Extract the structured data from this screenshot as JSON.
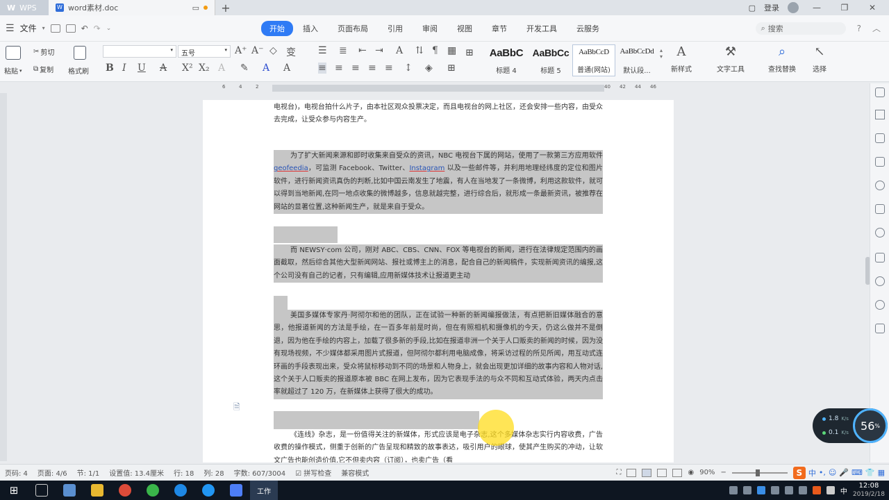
{
  "titlebar": {
    "app_tab": "WPS",
    "doc_tab": "word素材.doc",
    "add_tab": "+",
    "login": "登录"
  },
  "menubar": {
    "file": "文件",
    "tabs": [
      "开始",
      "插入",
      "页面布局",
      "引用",
      "审阅",
      "视图",
      "章节",
      "开发工具",
      "云服务"
    ],
    "active_tab": "开始",
    "search_placeholder": "搜索",
    "help": "?"
  },
  "ribbon": {
    "cut": "剪切",
    "copy": "复制",
    "paste": "粘贴",
    "format_painter": "格式刷",
    "font_name": "",
    "font_size": "五号",
    "styles": [
      {
        "sample": "AaBbC",
        "name": "标题 4"
      },
      {
        "sample": "AaBbCc",
        "name": "标题 5"
      },
      {
        "sample": "AaBbCcD",
        "name": "普通(网站)"
      },
      {
        "sample": "AaBbCcDd",
        "name": "默认段..."
      }
    ],
    "new_style": "新样式",
    "text_tools": "文字工具",
    "find_replace": "查找替换",
    "select": "选择"
  },
  "ruler": {
    "left_ticks": [
      "6",
      "4",
      "2"
    ],
    "right_ticks": [
      "40",
      "42",
      "44",
      "46"
    ]
  },
  "document": {
    "para0": "电视台)，电视台拍什么片子，由本社区观众投票决定，而且电视台的网上社区，还会安排一些内容，由受众去完成，让受众参与内容生产。",
    "para1_a": "为了扩大新闻来源和即时收集来自受众的资讯，NBC 电视台下属的网站，使用了一款第三方应用软件 ",
    "para1_link1": "geofeedia",
    "para1_b": "，可监测 Facebook、Twitter、",
    "para1_link2": "Instagram",
    "para1_c": " 以及一些邮件等，并利用地理经纬度的定位和图片软件，进行新闻资讯真伪的判断,比如中国云南发生了地震，有人在当地发了一条微博，利用这款软件，就可以得到当地新闻,在同一地点收集的微博越多，信息就越完整，进行综合后，就形成一条最新资讯，被推荐在网站的显著位置,这种新闻生产，就是来自于受众。",
    "para2": "而 NEWSY·com 公司，刚对 ABC、CBS、CNN、FOX 等电视台的新闻，进行在法律规定范围内的画面截取，然后综合其他大型新闻网站、报社或博主上的消息，配合自己的新闻稿件，实现新闻资讯的编报,这个公司没有自己的记者，只有编辑,应用新媒体技术让报道更主动",
    "para3": "美国多媒体专家丹·阿彻尔和他的团队，正在试验一种新的新闻编报做法，有点把新旧媒体融合的意思，他报道新闻的方法是手绘，在一百多年前是时尚，但在有照相机和摄像机的今天，仍这么做并不是倒退，因为他在手绘的内容上，加载了很多新的手段,比如在报道非洲一个关于人口贩卖的新闻的时候，因为没有现场视频，不少媒体都采用图片式报道，但阿彻尔都利用电脑成像，将采访过程的所见所闻，用互动式连环画的手段表现出来，受众将鼠标移动到不同的场景和人物身上，就会出现更加详细的故事内容和人物对话,这个关于人口贩卖的报道原本被 BBC 在网上发布，因为它表现手法的与众不同和互动式体验，两天内点击率就超过了 120 万，在新媒体上获得了很大的成功。",
    "para4": "《连线》杂志，是一份值得关注的新媒体，形式应该是电子杂志,这个多媒体杂志实行内容收费，广告收费的操作模式，侧重于创新的广告呈现和精致的故事表达，吸引用户的眼球，使其产生购买的冲动，让软文广告也能创造价值,它不但卖内容（订阅），也卖广告（看"
  },
  "speed_widget": {
    "up": "1.8",
    "up_unit": "K/s",
    "down": "0.1",
    "down_unit": "K/s",
    "percent": "56",
    "percent_unit": "%"
  },
  "statusbar": {
    "page_num": "页码: 4",
    "page": "页面: 4/6",
    "section": "节: 1/1",
    "setting": "设置值: 13.4厘米",
    "row": "行: 18",
    "col": "列: 28",
    "word_count": "字数: 607/3004",
    "spell_check": "拼写检查",
    "compat_mode": "兼容模式",
    "zoom": "90%",
    "ime_label": "中"
  },
  "taskbar": {
    "active_app": "工作",
    "time": "12:08",
    "date": "2019/2/18"
  }
}
